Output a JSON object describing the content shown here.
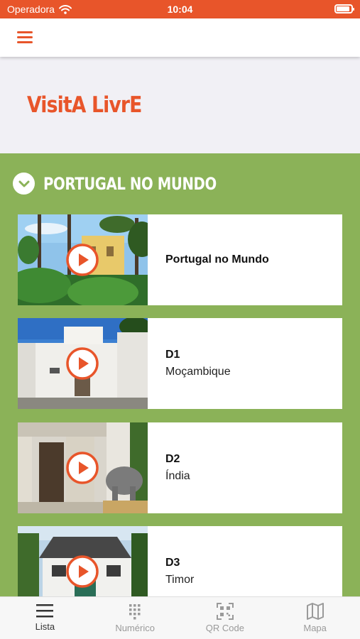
{
  "status_bar": {
    "carrier": "Operadora",
    "time": "10:04",
    "battery_level": 0.9
  },
  "app_bar": {
    "menu_icon": "hamburger-icon"
  },
  "logo": {
    "text": "VisitA LivrE"
  },
  "section": {
    "title": "PORTUGAL NO MUNDO",
    "icon": "chevron-down-icon"
  },
  "items": [
    {
      "code": "",
      "title": "Portugal no Mundo"
    },
    {
      "code": "D1",
      "title": "Moçambique"
    },
    {
      "code": "D2",
      "title": "Índia"
    },
    {
      "code": "D3",
      "title": "Timor"
    }
  ],
  "tabs": [
    {
      "label": "Lista",
      "icon": "list-icon",
      "active": true
    },
    {
      "label": "Numérico",
      "icon": "keypad-icon",
      "active": false
    },
    {
      "label": "QR Code",
      "icon": "qr-code-icon",
      "active": false
    },
    {
      "label": "Mapa",
      "icon": "map-icon",
      "active": false
    }
  ],
  "colors": {
    "accent": "#E8552A",
    "green": "#8BB258",
    "band": "#F1F0F5"
  }
}
